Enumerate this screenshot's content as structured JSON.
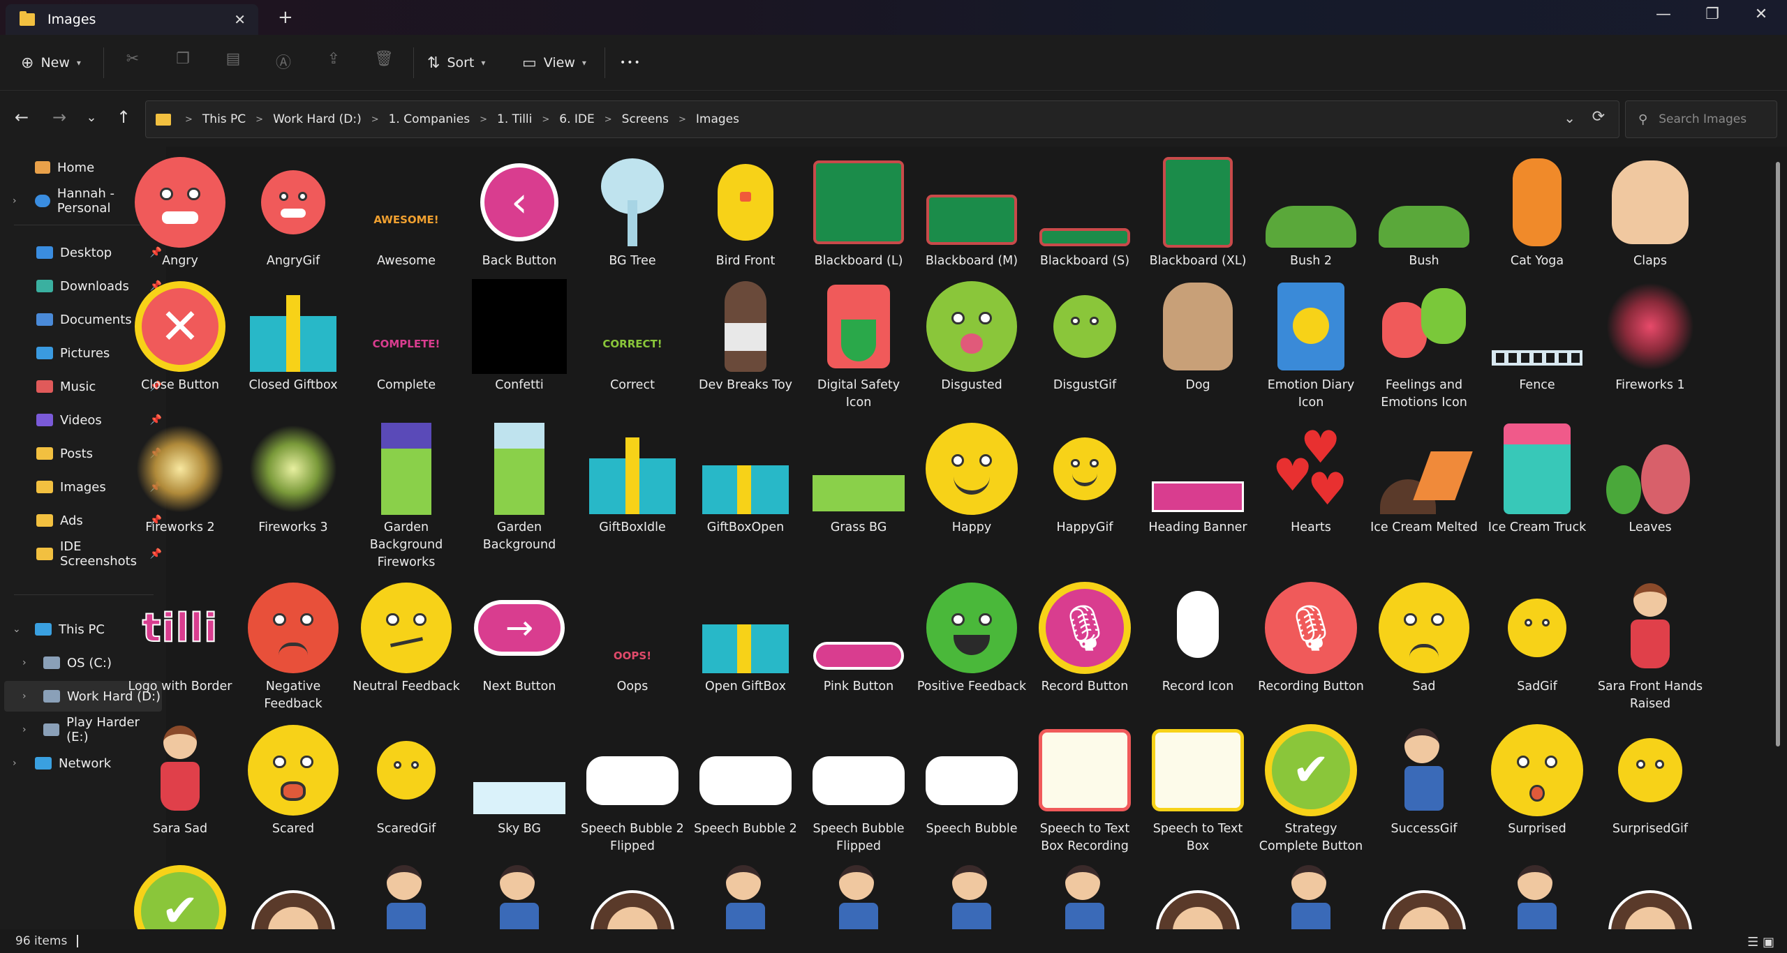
{
  "window": {
    "tab_title": "Images",
    "new_tab": "+",
    "minimize": "—",
    "maximize": "❐",
    "close": "✕"
  },
  "toolbar": {
    "new_label": "New",
    "sort_label": "Sort",
    "view_label": "View",
    "more": "•••"
  },
  "address": {
    "crumbs": [
      "This PC",
      "Work Hard (D:)",
      "1. Companies",
      "1. Tilli",
      "6. IDE",
      "Screens",
      "Images"
    ],
    "search_placeholder": "Search Images"
  },
  "sidebar": {
    "home": "Home",
    "personal": "Hannah - Personal",
    "pinned": [
      "Desktop",
      "Downloads",
      "Documents",
      "Pictures",
      "Music",
      "Videos",
      "Posts",
      "Images",
      "Ads",
      "IDE Screenshots"
    ],
    "this_pc": "This PC",
    "drives": [
      "OS (C:)",
      "Work Hard (D:)",
      "Play Harder (E:)"
    ],
    "network": "Network"
  },
  "items": [
    {
      "label": "Angry",
      "icon": "angry-face"
    },
    {
      "label": "AngryGif",
      "icon": "angry-face-small"
    },
    {
      "label": "Awesome",
      "icon": "awesome-text"
    },
    {
      "label": "Back Button",
      "icon": "back-button"
    },
    {
      "label": "BG Tree",
      "icon": "tree"
    },
    {
      "label": "Bird Front",
      "icon": "bird"
    },
    {
      "label": "Blackboard (L)",
      "icon": "blackboard-l"
    },
    {
      "label": "Blackboard (M)",
      "icon": "blackboard-m"
    },
    {
      "label": "Blackboard (S)",
      "icon": "blackboard-s"
    },
    {
      "label": "Blackboard (XL)",
      "icon": "blackboard-xl"
    },
    {
      "label": "Bush 2",
      "icon": "bush"
    },
    {
      "label": "Bush",
      "icon": "bush"
    },
    {
      "label": "Cat Yoga",
      "icon": "cat"
    },
    {
      "label": "Claps",
      "icon": "claps"
    },
    {
      "label": "Close Button",
      "icon": "close-button"
    },
    {
      "label": "Closed Giftbox",
      "icon": "giftbox"
    },
    {
      "label": "Complete",
      "icon": "complete-text"
    },
    {
      "label": "Confetti",
      "icon": "confetti"
    },
    {
      "label": "Correct",
      "icon": "correct-text"
    },
    {
      "label": "Dev Breaks Toy",
      "icon": "kid"
    },
    {
      "label": "Digital Safety Icon",
      "icon": "shield"
    },
    {
      "label": "Disgusted",
      "icon": "disgust-face"
    },
    {
      "label": "DisgustGif",
      "icon": "disgust-face-small"
    },
    {
      "label": "Dog",
      "icon": "dog"
    },
    {
      "label": "Emotion Diary Icon",
      "icon": "diary"
    },
    {
      "label": "Feelings and Emotions Icon",
      "icon": "masks"
    },
    {
      "label": "Fence",
      "icon": "fence"
    },
    {
      "label": "Fireworks 1",
      "icon": "fireworks-red"
    },
    {
      "label": "Fireworks 2",
      "icon": "fireworks-gold"
    },
    {
      "label": "Fireworks 3",
      "icon": "fireworks-green"
    },
    {
      "label": "Garden Background Fireworks",
      "icon": "garden-fireworks"
    },
    {
      "label": "Garden Background",
      "icon": "garden"
    },
    {
      "label": "GiftBoxIdle",
      "icon": "giftbox"
    },
    {
      "label": "GiftBoxOpen",
      "icon": "giftbox-open"
    },
    {
      "label": "Grass BG",
      "icon": "grass"
    },
    {
      "label": "Happy",
      "icon": "happy-face"
    },
    {
      "label": "HappyGif",
      "icon": "happy-face-small"
    },
    {
      "label": "Heading Banner",
      "icon": "banner"
    },
    {
      "label": "Hearts",
      "icon": "hearts"
    },
    {
      "label": "Ice Cream Melted",
      "icon": "ice-cream-melted"
    },
    {
      "label": "Ice Cream Truck",
      "icon": "ice-cream-truck"
    },
    {
      "label": "Leaves",
      "icon": "leaves"
    },
    {
      "label": "Logo with Border",
      "icon": "logo"
    },
    {
      "label": "Negative Feedback",
      "icon": "negative-face"
    },
    {
      "label": "Neutral Feedback",
      "icon": "neutral-face"
    },
    {
      "label": "Next Button",
      "icon": "next-button"
    },
    {
      "label": "Oops",
      "icon": "oops-text"
    },
    {
      "label": "Open GiftBox",
      "icon": "giftbox-open"
    },
    {
      "label": "Pink Button",
      "icon": "pink-button"
    },
    {
      "label": "Positive Feedback",
      "icon": "positive-face"
    },
    {
      "label": "Record Button",
      "icon": "record-button"
    },
    {
      "label": "Record Icon",
      "icon": "mic"
    },
    {
      "label": "Recording Button",
      "icon": "recording-button"
    },
    {
      "label": "Sad",
      "icon": "sad-face"
    },
    {
      "label": "SadGif",
      "icon": "sad-face-small"
    },
    {
      "label": "Sara Front Hands Raised",
      "icon": "girl"
    },
    {
      "label": "Sara Sad",
      "icon": "girl"
    },
    {
      "label": "Scared",
      "icon": "scared-face"
    },
    {
      "label": "ScaredGif",
      "icon": "scared-face-small"
    },
    {
      "label": "Sky BG",
      "icon": "sky"
    },
    {
      "label": "Speech Bubble 2 Flipped",
      "icon": "speech-bubble"
    },
    {
      "label": "Speech Bubble 2",
      "icon": "speech-bubble"
    },
    {
      "label": "Speech Bubble Flipped",
      "icon": "speech-bubble"
    },
    {
      "label": "Speech Bubble",
      "icon": "speech-bubble"
    },
    {
      "label": "Speech to Text Box Recording",
      "icon": "stt-box-red"
    },
    {
      "label": "Speech to Text Box",
      "icon": "stt-box-yellow"
    },
    {
      "label": "Strategy Complete Button",
      "icon": "check-button"
    },
    {
      "label": "SuccessGif",
      "icon": "kid-girl"
    },
    {
      "label": "Surprised",
      "icon": "surprised-face"
    },
    {
      "label": "SurprisedGif",
      "icon": "surprised-face-small"
    }
  ],
  "partial_row": [
    "check-button",
    "girl-face",
    "kid-girl",
    "kid-girl",
    "girl-face",
    "kid-girl",
    "kid-girl",
    "kid-girl",
    "kid-girl",
    "girl-face",
    "kid-girl",
    "girl-face",
    "kid-girl",
    "girl-face"
  ],
  "status": {
    "count": "96 items"
  },
  "colors": {
    "accent_yellow": "#f7d218",
    "red": "#f05a5a",
    "pink": "#d93d8f",
    "green": "#1b8c4a"
  },
  "text_art": {
    "awesome": "AWESOME!",
    "complete": "COMPLETE!",
    "correct": "CORRECT!",
    "oops": "OOPS!",
    "logo": "tilli"
  }
}
